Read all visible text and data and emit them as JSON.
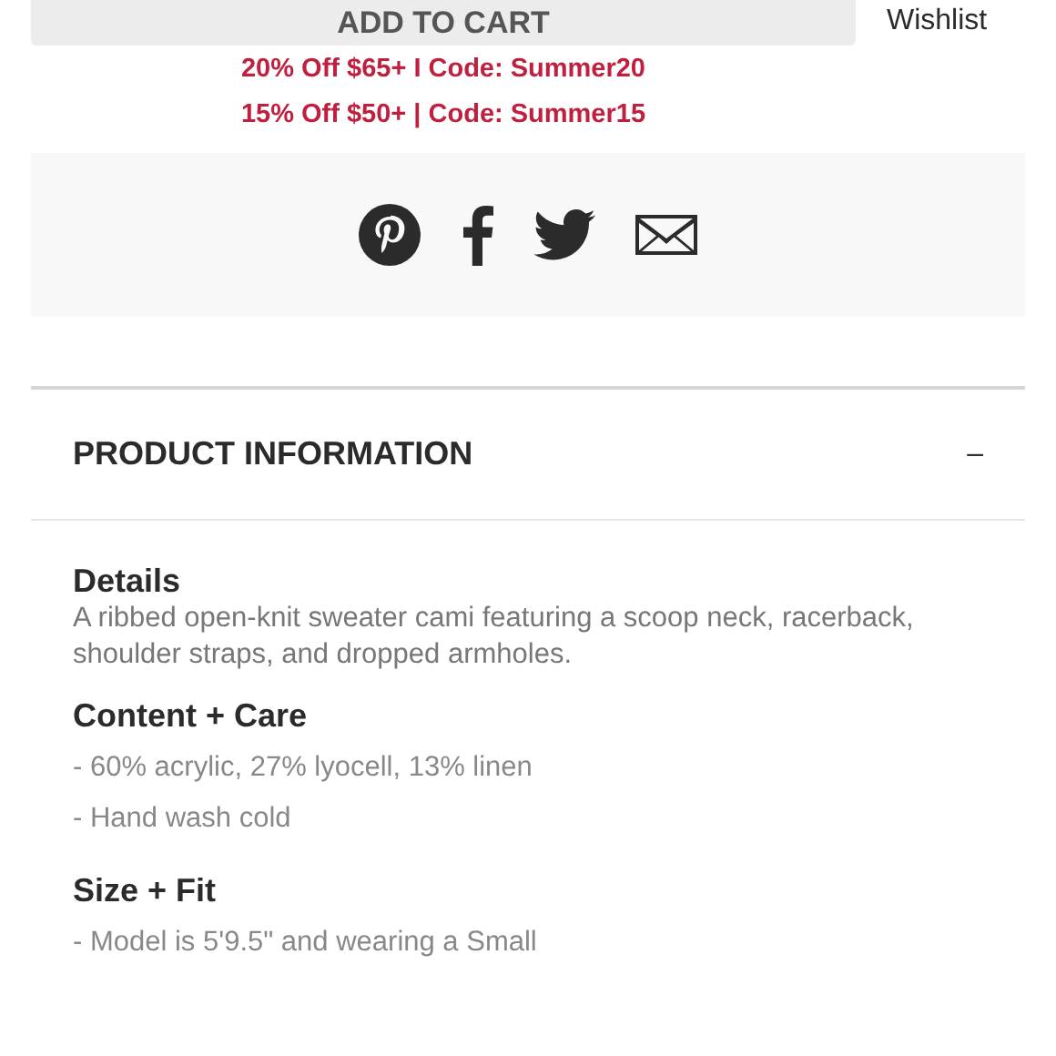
{
  "cart_button": {
    "label": "ADD TO CART"
  },
  "wishlist": {
    "label": "Wishlist"
  },
  "promos": [
    "20% Off $65+ I Code: Summer20",
    "15% Off $50+ | Code: Summer15"
  ],
  "share": [
    {
      "kind": "pinterest"
    },
    {
      "kind": "facebook"
    },
    {
      "kind": "twitter"
    },
    {
      "kind": "email"
    }
  ],
  "product_info": {
    "title": "PRODUCT INFORMATION",
    "toggle": "–",
    "expanded": true,
    "sections": [
      {
        "heading": "Details",
        "kind": "paragraph",
        "lines": [
          "A ribbed open-knit sweater cami featuring a scoop neck, racerback, shoulder straps, and dropped armholes."
        ]
      },
      {
        "heading": "Content + Care",
        "kind": "list",
        "lines": [
          "- 60% acrylic, 27% lyocell, 13% linen",
          "- Hand wash cold"
        ]
      },
      {
        "heading": "Size + Fit",
        "kind": "list",
        "lines": [
          "- Model is 5'9.5\" and wearing a Small"
        ]
      }
    ]
  }
}
